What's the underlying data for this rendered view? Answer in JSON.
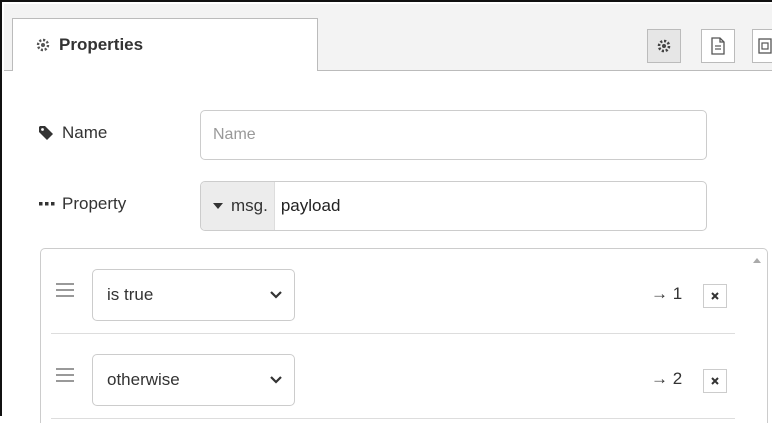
{
  "tab": {
    "label": "Properties"
  },
  "form": {
    "name": {
      "label": "Name",
      "placeholder": "Name",
      "value": ""
    },
    "property": {
      "label": "Property",
      "type_prefix": "msg.",
      "value": "payload"
    }
  },
  "rules": [
    {
      "operator": "is true",
      "output": "→ 1"
    },
    {
      "operator": "otherwise",
      "output": "→ 2"
    }
  ],
  "icons": {
    "tab": "gear-icon",
    "toolbar": [
      "gear-icon",
      "document-icon",
      "frame-icon"
    ],
    "name_label": "tag-icon",
    "property_label": "ellipsis-icon",
    "type_select": "caret-down-icon",
    "rule_handle": "drag-handle-icon",
    "rule_select": "chevron-down-icon",
    "rule_delete": "close-icon"
  }
}
